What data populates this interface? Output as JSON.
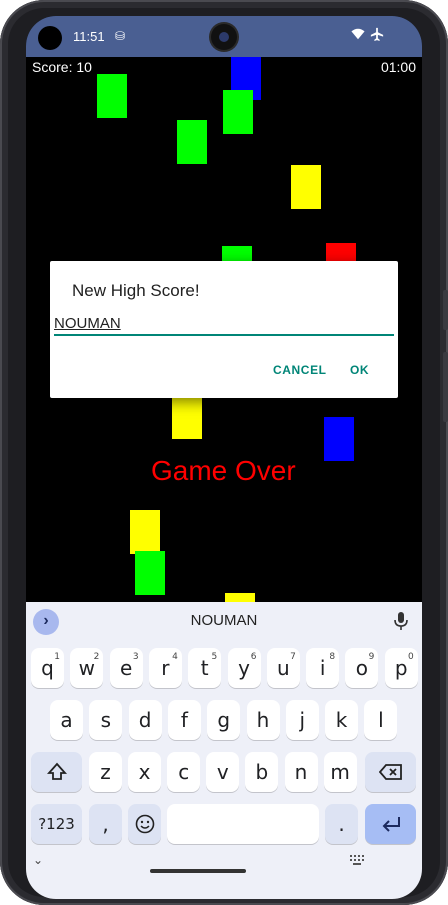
{
  "status_bar": {
    "time": "11:51",
    "notification_icon": "sync-icon",
    "icons": [
      "wifi-icon",
      "airplane-icon"
    ]
  },
  "game": {
    "score_text": "Score: 10",
    "timer_text": "01:00",
    "game_over_text": "Game Over",
    "colors": {
      "green": "#00ff00",
      "blue": "#0000ff",
      "yellow": "#ffff00",
      "red": "#ff0000"
    }
  },
  "dialog": {
    "title": "New High Score!",
    "name_value": "NOUMAN",
    "cancel_label": "CANCEL",
    "ok_label": "OK",
    "accent": "#008577"
  },
  "keyboard": {
    "suggestion": "NOUMAN",
    "row1": [
      "q",
      "w",
      "e",
      "r",
      "t",
      "y",
      "u",
      "i",
      "o",
      "p"
    ],
    "row1_hints": [
      "1",
      "2",
      "3",
      "4",
      "5",
      "6",
      "7",
      "8",
      "9",
      "0"
    ],
    "row2": [
      "a",
      "s",
      "d",
      "f",
      "g",
      "h",
      "j",
      "k",
      "l"
    ],
    "row3": [
      "z",
      "x",
      "c",
      "v",
      "b",
      "n",
      "m"
    ],
    "symbols_label": "?123",
    "comma": ",",
    "period": ".",
    "shift_icon": "shift-icon",
    "backspace_icon": "backspace-icon",
    "emoji_icon": "emoji-icon",
    "enter_icon": "enter-icon",
    "mic_icon": "mic-icon"
  }
}
